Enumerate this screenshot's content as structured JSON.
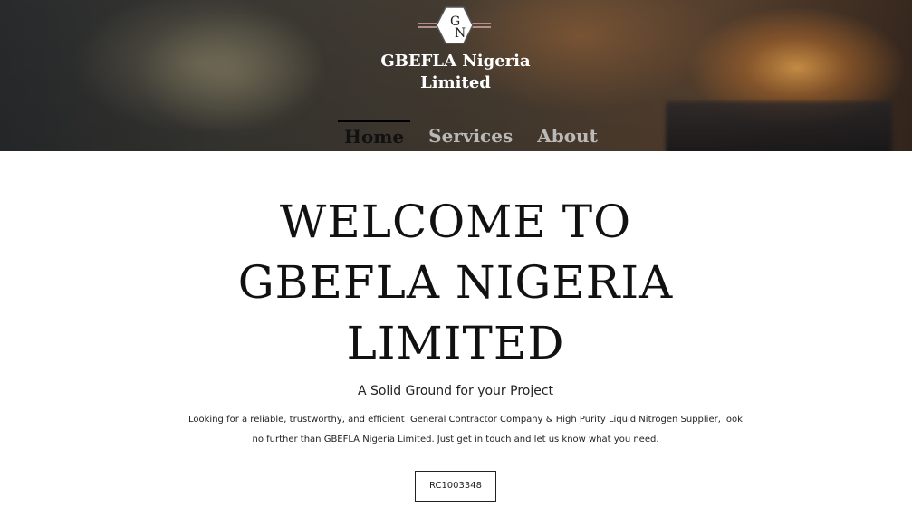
{
  "header": {
    "logo_letters": [
      "G",
      "N"
    ],
    "brand_name_line1": "GBEFLA Nigeria",
    "brand_name_line2": "Limited"
  },
  "nav": {
    "items": [
      {
        "label": "Home",
        "active": true
      },
      {
        "label": "Services",
        "active": false
      },
      {
        "label": "About",
        "active": false
      }
    ]
  },
  "main": {
    "headline_line1": "WELCOME TO",
    "headline_line2": "GBEFLA NIGERIA",
    "headline_line3": "LIMITED",
    "tagline": "A Solid Ground for your Project",
    "intro_line1": "Looking for a reliable, trustworthy, and efficient  General Contractor Company & High Purity Liquid Nitrogen Supplier, look",
    "intro_line2": "no further than GBEFLA Nigeria Limited. Just get in touch and let us know what you need.",
    "registration_number": "RC1003348"
  },
  "colors": {
    "text_dark": "#111111",
    "nav_inactive": "#c8c8c8",
    "white": "#ffffff"
  }
}
